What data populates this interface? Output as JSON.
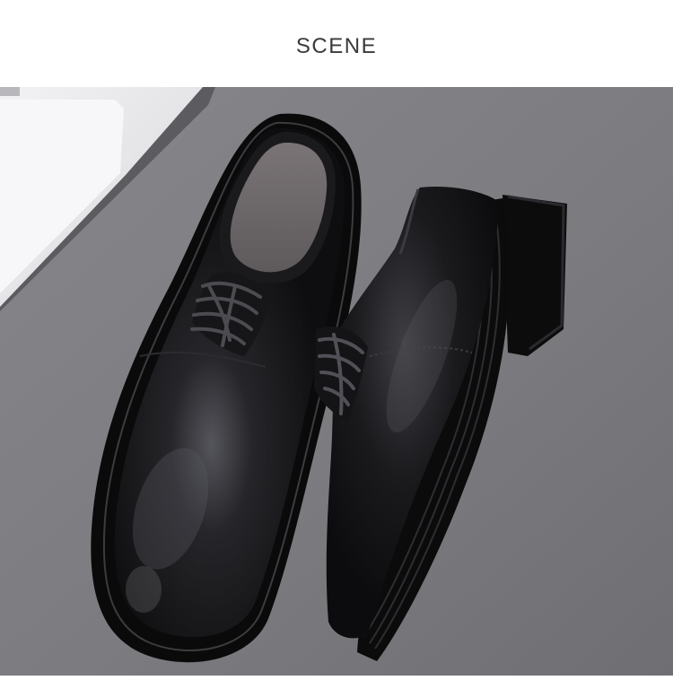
{
  "section": {
    "title": "SCENE"
  },
  "photo": {
    "subject": "pair-of-black-leather-derby-shoes",
    "props": [
      "laptop-corner"
    ],
    "colors": {
      "background": "#7c7c80",
      "background_light": "#8a8a8e",
      "leather": "#121214",
      "leather_highlight": "#4a4a50",
      "sole": "#0b0b0c",
      "insole": "#6f6a6c",
      "laptop": "#e9e9ec"
    }
  }
}
